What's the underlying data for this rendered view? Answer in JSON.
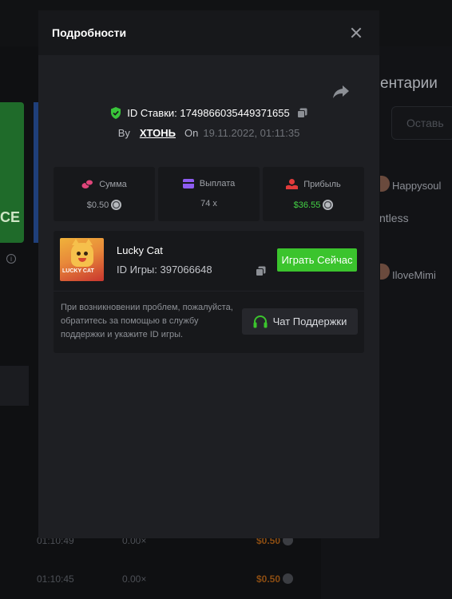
{
  "modal": {
    "title": "Подробности",
    "bet_id": "ID Ставки: 1749866035449371655",
    "by_label": "By",
    "username": "ХТОНЬ",
    "on_label": "On",
    "date": "19.11.2022, 01:11:35"
  },
  "stats": [
    {
      "label": "Сумма",
      "value": "$0.50",
      "icon": "coins-icon",
      "color": "#e0457a"
    },
    {
      "label": "Выплата",
      "value": "74 x",
      "icon": "wallet-icon",
      "color": "#8e5cf0"
    },
    {
      "label": "Прибыль",
      "value": "$36.55",
      "icon": "profit-icon",
      "color": "#e23b3b"
    }
  ],
  "game": {
    "name": "Lucky Cat",
    "id": "ID Игры: 397066648",
    "thumb_text": "LUCKY CAT",
    "play_label": "Играть Сейчас"
  },
  "help": {
    "text": "При возникновении проблем, пожалуйста, обратитесь за помощью в службу поддержки и укажите ID игры.",
    "support_label": "Чат Поддержки"
  },
  "background": {
    "comments_title": "ентарии",
    "comment_placeholder": "Оставь",
    "users": [
      "Happysoul",
      "ntless",
      "IloveMimi"
    ],
    "card_text": "CE",
    "rows": [
      {
        "time": "01:10:49",
        "mult": "0.00×",
        "amount": "$0.50"
      },
      {
        "time": "01:10:45",
        "mult": "0.00×",
        "amount": "$0.50"
      }
    ]
  },
  "colors": {
    "accent_green": "#3bc42d",
    "profit_green": "#43d245",
    "modal_bg": "#1e1f23"
  }
}
